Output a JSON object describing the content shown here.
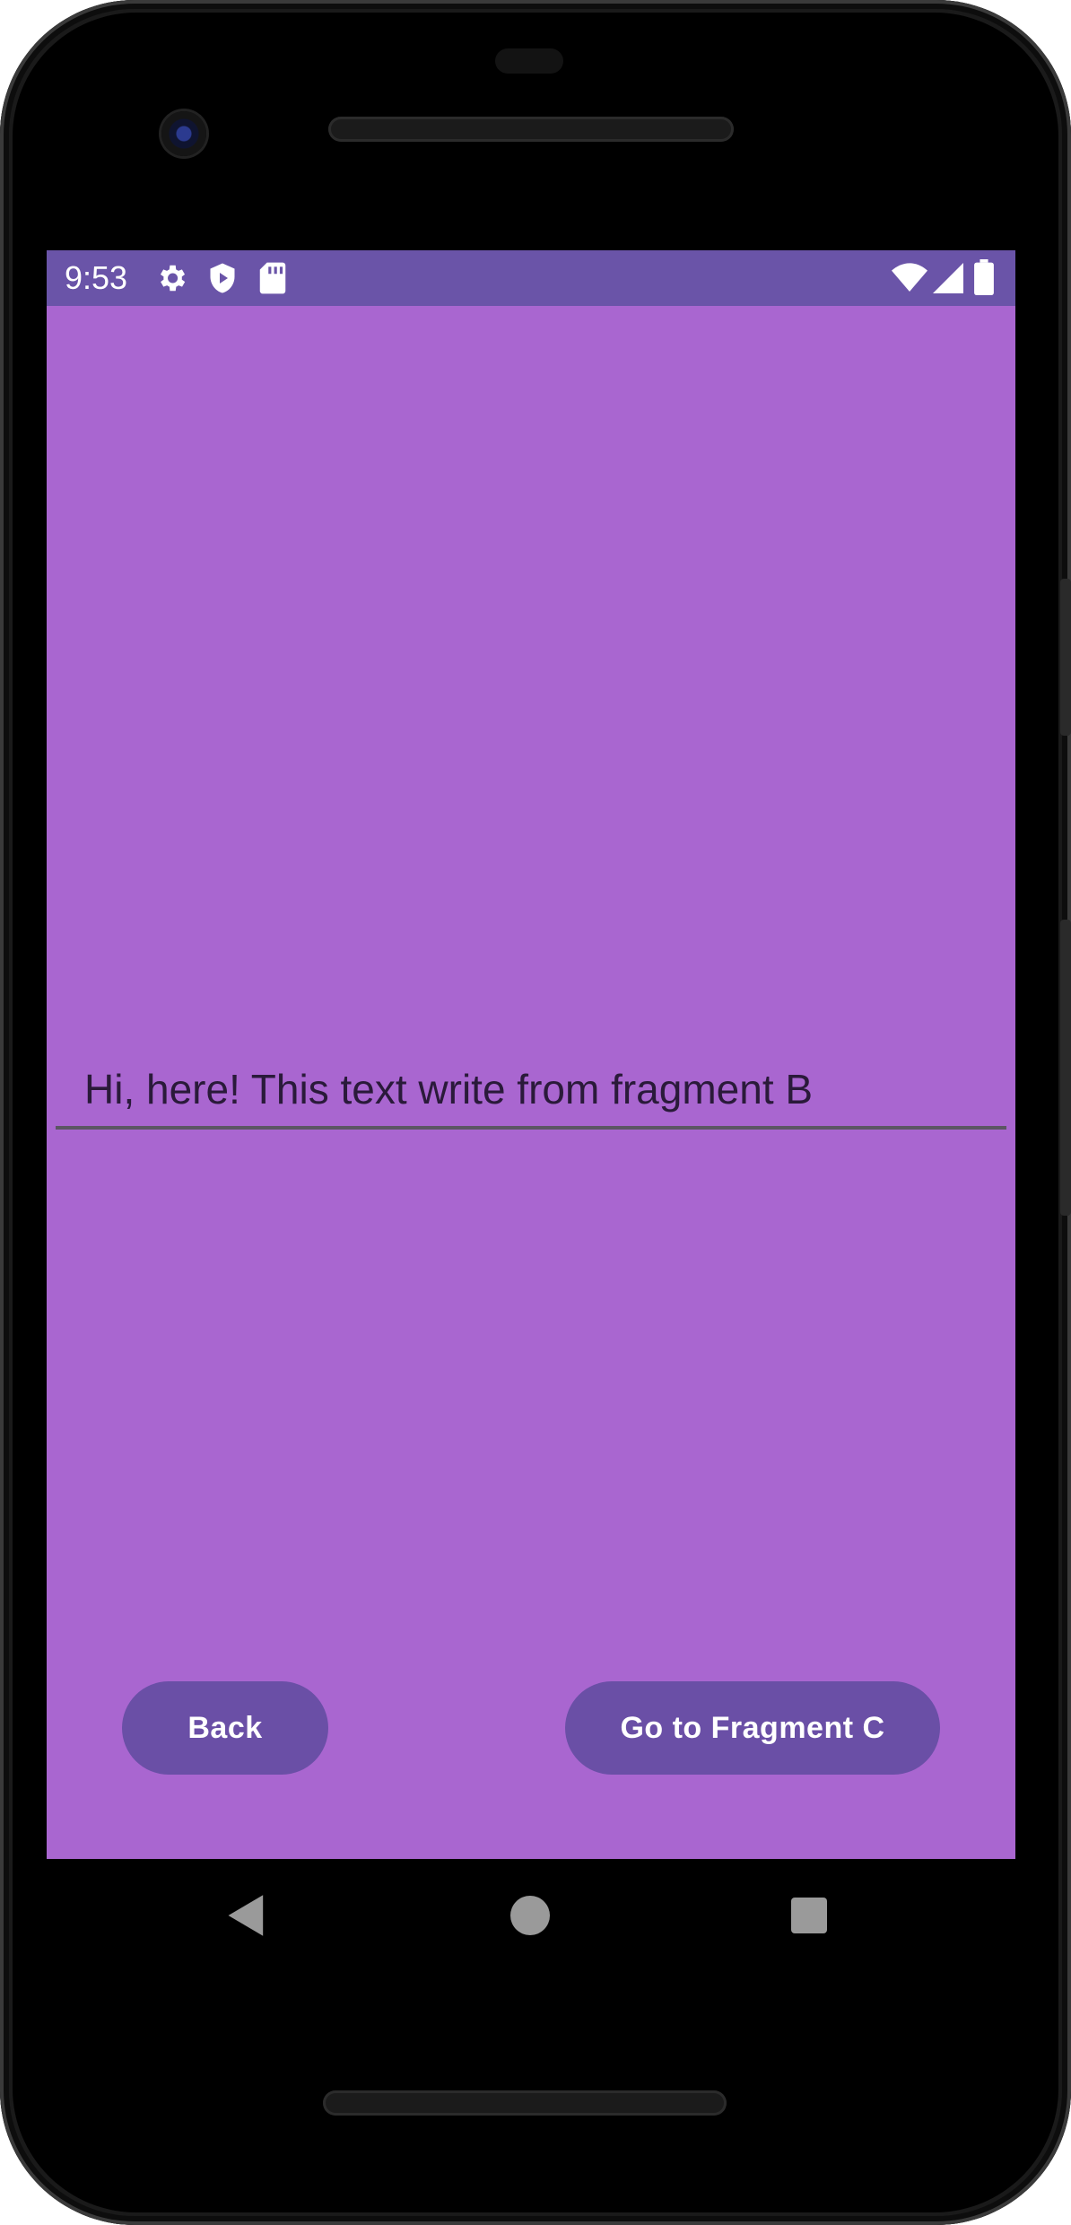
{
  "status_bar": {
    "time": "9:53",
    "icons": [
      "settings-icon",
      "shield-play-icon",
      "sd-card-icon",
      "wifi-icon",
      "cell-signal-icon",
      "battery-icon"
    ],
    "background": "#6a54a8"
  },
  "screen": {
    "background": "#a966d0"
  },
  "text_field": {
    "value": "Hi, here! This text write from fragment B"
  },
  "buttons": {
    "back_label": "Back",
    "next_label": "Go to Fragment C",
    "color": "#6a4fa6"
  },
  "nav_bar": {
    "icons": [
      "nav-back-icon",
      "nav-home-icon",
      "nav-recents-icon"
    ]
  }
}
